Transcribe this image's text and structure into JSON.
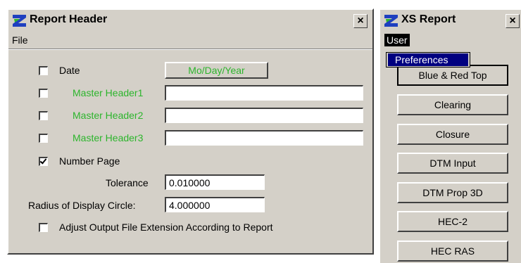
{
  "report_header": {
    "title": "Report Header",
    "close_label": "×",
    "menu": [
      "File"
    ],
    "date_label": "Date",
    "date_format": "Mo/Day/Year",
    "master_headers": [
      {
        "label": "Master Header1",
        "value": ""
      },
      {
        "label": "Master Header2",
        "value": ""
      },
      {
        "label": "Master Header3",
        "value": ""
      }
    ],
    "number_page_label": "Number Page",
    "tolerance_label": "Tolerance",
    "tolerance_value": "0.010000",
    "radius_label": "Radius of Display Circle:",
    "radius_value": "4.000000",
    "adjust_label": "Adjust Output File Extension According to Report",
    "checkboxes": {
      "date": false,
      "header1": false,
      "header2": false,
      "header3": false,
      "number_page": true,
      "adjust": false
    }
  },
  "xs_report": {
    "title": "XS Report",
    "close_label": "×",
    "menu": [
      "User"
    ],
    "popup_item": "Preferences",
    "buttons": [
      "Blue & Red Top",
      "Clearing",
      "Closure",
      "DTM Input",
      "DTM Prop 3D",
      "HEC-2",
      "HEC RAS"
    ]
  },
  "colors": {
    "label_green": "#2cb52c",
    "menu_highlight": "#000080",
    "window_face": "#d4d0c8"
  },
  "icons": [
    "app-logo-icon",
    "close-icon",
    "checkmark-icon"
  ]
}
